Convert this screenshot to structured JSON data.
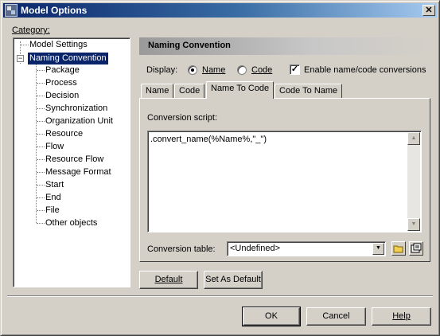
{
  "window": {
    "title": "Model Options",
    "close_glyph": "✕"
  },
  "category": {
    "label": "Category:",
    "tree": [
      "Model Settings",
      "Naming Convention",
      "Package",
      "Process",
      "Decision",
      "Synchronization",
      "Organization Unit",
      "Resource",
      "Flow",
      "Resource Flow",
      "Message Format",
      "Start",
      "End",
      "File",
      "Other objects"
    ],
    "selected": "Naming Convention",
    "toggle_glyph": "−"
  },
  "panel": {
    "header": "Naming Convention",
    "display_label": "Display:",
    "radio_name": "Name",
    "radio_code": "Code",
    "radio_selected": "Name",
    "enable_conversions_label": "Enable name/code conversions",
    "enable_conversions_checked": true,
    "check_glyph": "✓",
    "tabs": [
      "Name",
      "Code",
      "Name To Code",
      "Code To Name"
    ],
    "active_tab": "Name To Code",
    "conversion_script_label": "Conversion script:",
    "conversion_script_value": ".convert_name(%Name%,\"_\")",
    "conversion_table_label": "Conversion table:",
    "conversion_table_value": "<Undefined>",
    "default_button": "Default",
    "set_default_button": "Set As Default"
  },
  "footer": {
    "ok": "OK",
    "cancel": "Cancel",
    "help": "Help"
  },
  "icons": {
    "scroll_up": "▲",
    "scroll_down": "▼",
    "dropdown": "▼",
    "folder": "folder-icon",
    "properties": "properties-icon"
  }
}
